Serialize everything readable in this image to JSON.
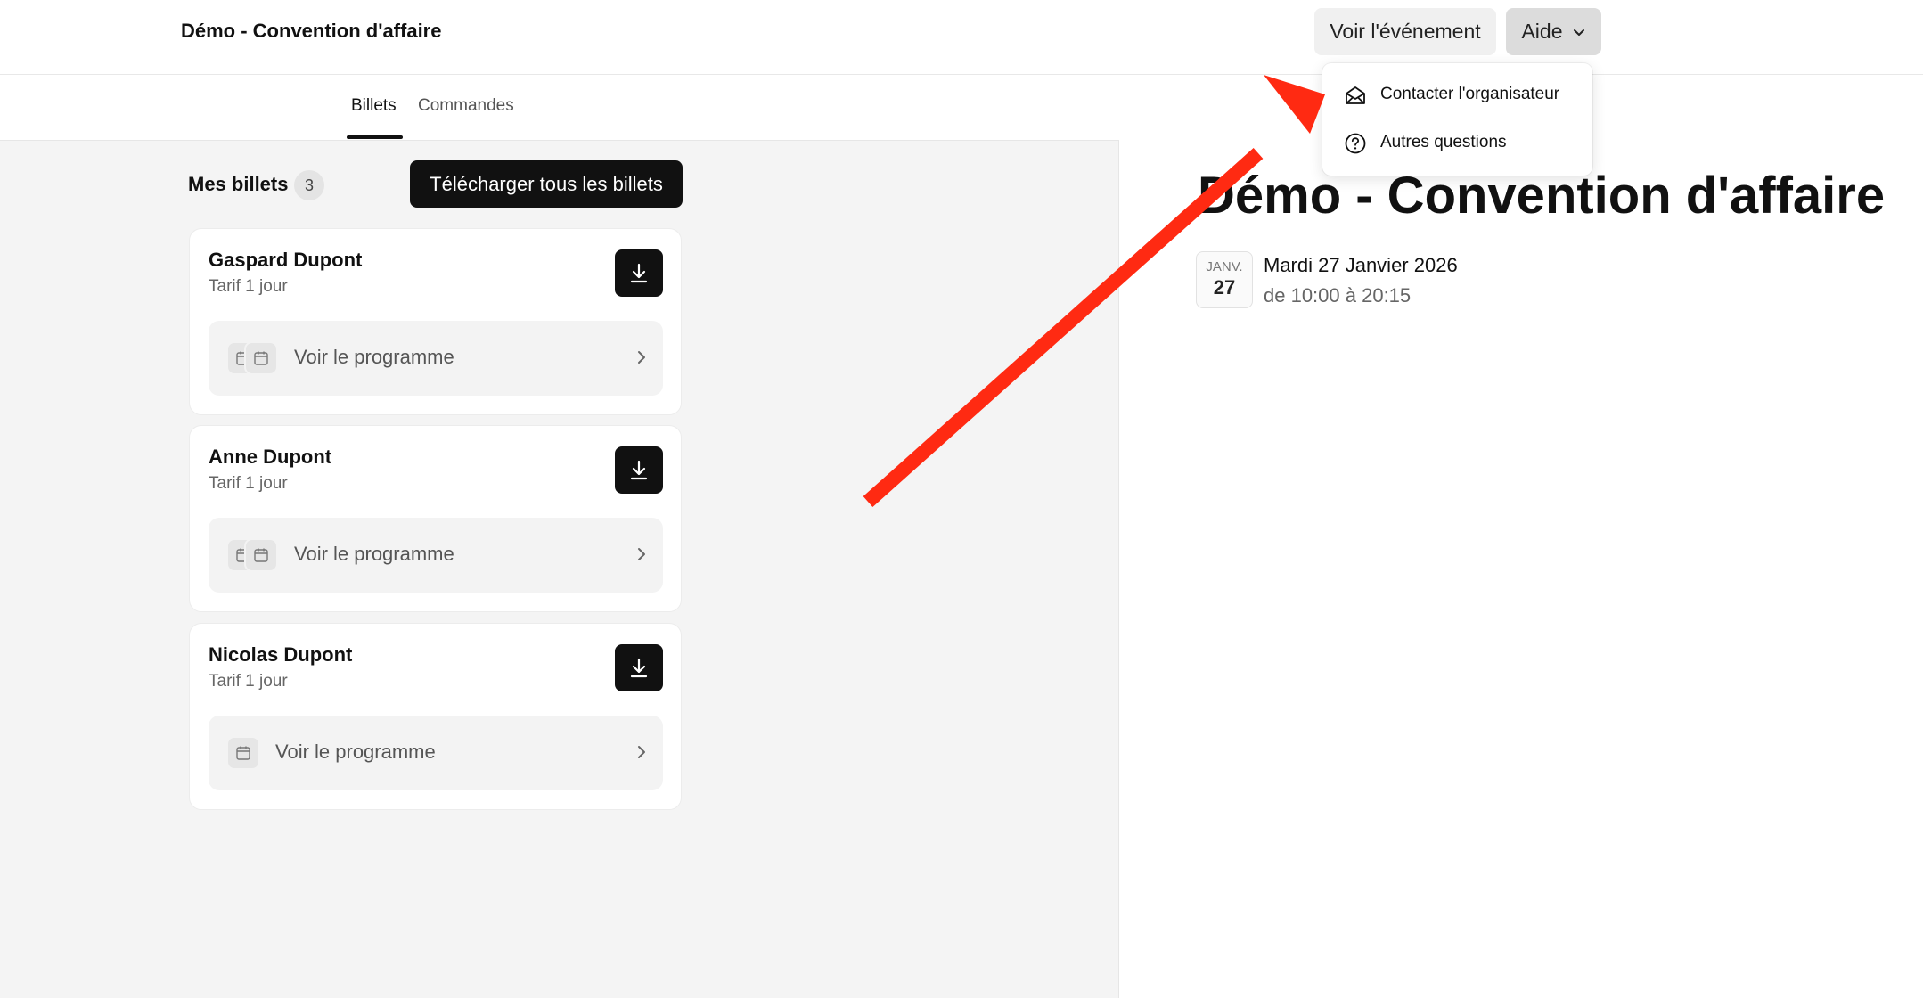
{
  "header": {
    "title": "Démo - Convention d'affaire",
    "view_event_label": "Voir l'événement",
    "help_label": "Aide"
  },
  "tabs": [
    {
      "label": "Billets",
      "active": true
    },
    {
      "label": "Commandes",
      "active": false
    }
  ],
  "tickets_section": {
    "title": "Mes billets",
    "count": "3",
    "download_all_label": "Télécharger tous les billets"
  },
  "tickets": [
    {
      "name": "Gaspard Dupont",
      "tarif": "Tarif 1 jour",
      "program_label": "Voir le programme"
    },
    {
      "name": "Anne Dupont",
      "tarif": "Tarif 1 jour",
      "program_label": "Voir le programme"
    },
    {
      "name": "Nicolas Dupont",
      "tarif": "Tarif 1 jour",
      "program_label": "Voir le programme"
    }
  ],
  "event": {
    "title": "Démo - Convention d'affaire",
    "month": "JANV.",
    "day": "27",
    "date": "Mardi 27 Janvier 2026",
    "time": "de 10:00 à 20:15"
  },
  "help_menu": {
    "items": [
      {
        "label": "Contacter l'organisateur",
        "icon": "envelope-open-icon"
      },
      {
        "label": "Autres questions",
        "icon": "question-circle-icon"
      }
    ]
  },
  "annotation": {
    "arrow_color": "#ff2a12"
  }
}
